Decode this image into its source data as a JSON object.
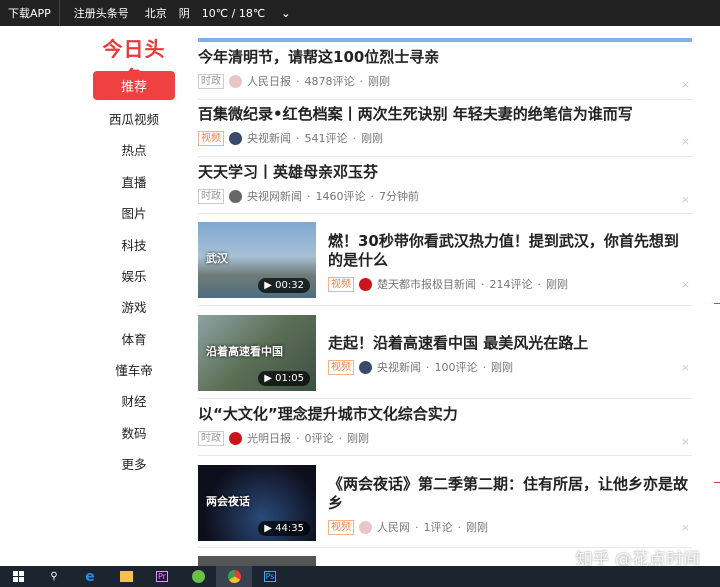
{
  "topbar": {
    "download": "下载APP",
    "register": "注册头条号",
    "city": "北京",
    "weather": "阴",
    "temp": "10℃ / 18℃",
    "chevron": "⌄"
  },
  "logo": "今日头条",
  "nav": [
    "推荐",
    "西瓜视频",
    "热点",
    "直播",
    "图片",
    "科技",
    "娱乐",
    "游戏",
    "体育",
    "懂车帝",
    "财经",
    "数码",
    "更多"
  ],
  "articles": [
    {
      "title": "今年清明节，请帮这100位烈士寻亲",
      "tag": "时政",
      "source": "人民日报",
      "comments": "4878评论",
      "time": "刚刚"
    },
    {
      "title": "百集微纪录•红色档案丨两次生死诀别 年轻夫妻的绝笔信为谁而写",
      "tag": "视频",
      "source": "央视新闻",
      "comments": "541评论",
      "time": "刚刚"
    },
    {
      "title": "天天学习丨英雄母亲邓玉芬",
      "tag": "时政",
      "source": "央视网新闻",
      "comments": "1460评论",
      "time": "7分钟前"
    },
    {
      "title": "燃！30秒带你看武汉热力值！提到武汉，你首先想到的是什么",
      "tag": "视频",
      "source": "楚天都市报极目新闻",
      "comments": "214评论",
      "time": "刚刚",
      "duration": "00:32",
      "thumb_text": "武汉"
    },
    {
      "title": "走起！沿着高速看中国 最美风光在路上",
      "tag": "视频",
      "source": "央视新闻",
      "comments": "100评论",
      "time": "刚刚",
      "duration": "01:05",
      "thumb_text": "沿着高速看中国"
    },
    {
      "title": "以“大文化”理念提升城市文化综合实力",
      "tag": "时政",
      "source": "光明日报",
      "comments": "0评论",
      "time": "刚刚"
    },
    {
      "title": "《两会夜话》第二季第二期：住有所居，让他乡亦是故乡",
      "tag": "视频",
      "source": "人民网",
      "comments": "1评论",
      "time": "刚刚",
      "duration": "44:35",
      "thumb_text": "两会夜话"
    }
  ],
  "close": "×",
  "watermark": "知乎 @花点时间",
  "taskbar": [
    "windows-start",
    "search",
    "edge",
    "file-explorer",
    "premiere",
    "app-green",
    "chrome",
    "photoshop"
  ]
}
